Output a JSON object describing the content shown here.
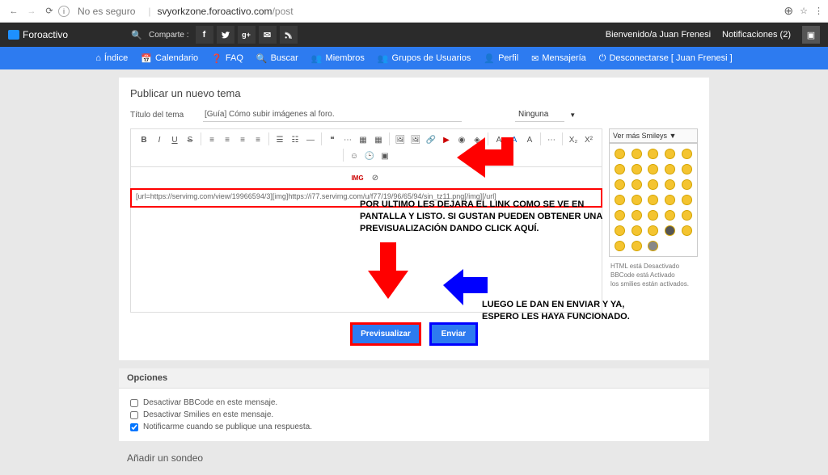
{
  "browser": {
    "security_label": "No es seguro",
    "domain": "svyorkzone.foroactivo.com",
    "path": "/post"
  },
  "top": {
    "brand": "Foroactivo",
    "share_label": "Comparte :",
    "welcome": "Bienvenido/a Juan Frenesi",
    "notifications": "Notificaciones  (2)"
  },
  "nav": {
    "indice": "Índice",
    "calendario": "Calendario",
    "faq": "FAQ",
    "buscar": "Buscar",
    "miembros": "Miembros",
    "grupos": "Grupos de Usuarios",
    "perfil": "Perfil",
    "mensajeria": "Mensajería",
    "desconectarse": "Desconectarse [ Juan Frenesi ]"
  },
  "panel": {
    "title": "Publicar un nuevo tema",
    "label_titulo": "Título del tema",
    "titulo_value": "[Guía] Cómo subir imágenes al foro.",
    "select_value": "Ninguna"
  },
  "editor": {
    "message": "[url=https://servimg.com/view/19966594/3][img]https://i77.servimg.com/u/f77/19/96/65/94/sin_tz11.png[/img][/url]"
  },
  "smileys": {
    "header": "Ver más Smileys ▼",
    "info_html": "HTML está Desactivado",
    "info_bb": "BBCode está Activado",
    "info_sm": "los smilies están activados."
  },
  "annotations": {
    "msg1": "POR ULTIMO LES DEJARA EL LINK COMO SE VE EN PANTALLA Y LISTO. SI GUSTAN PUEDEN OBTENER UNA PREVISUALIZACIÓN DANDO CLICK AQUÍ.",
    "msg2": "LUEGO LE DAN EN ENVIAR Y YA, ESPERO LES HAYA FUNCIONADO."
  },
  "buttons": {
    "preview": "Previsualizar",
    "send": "Enviar"
  },
  "options": {
    "title": "Opciones",
    "bbcode": "Desactivar BBCode en este mensaje.",
    "smilies": "Desactivar Smilies en este mensaje.",
    "notify": "Notificarme cuando se publique una respuesta."
  },
  "sondeo": {
    "title": "Añadir un sondeo"
  }
}
